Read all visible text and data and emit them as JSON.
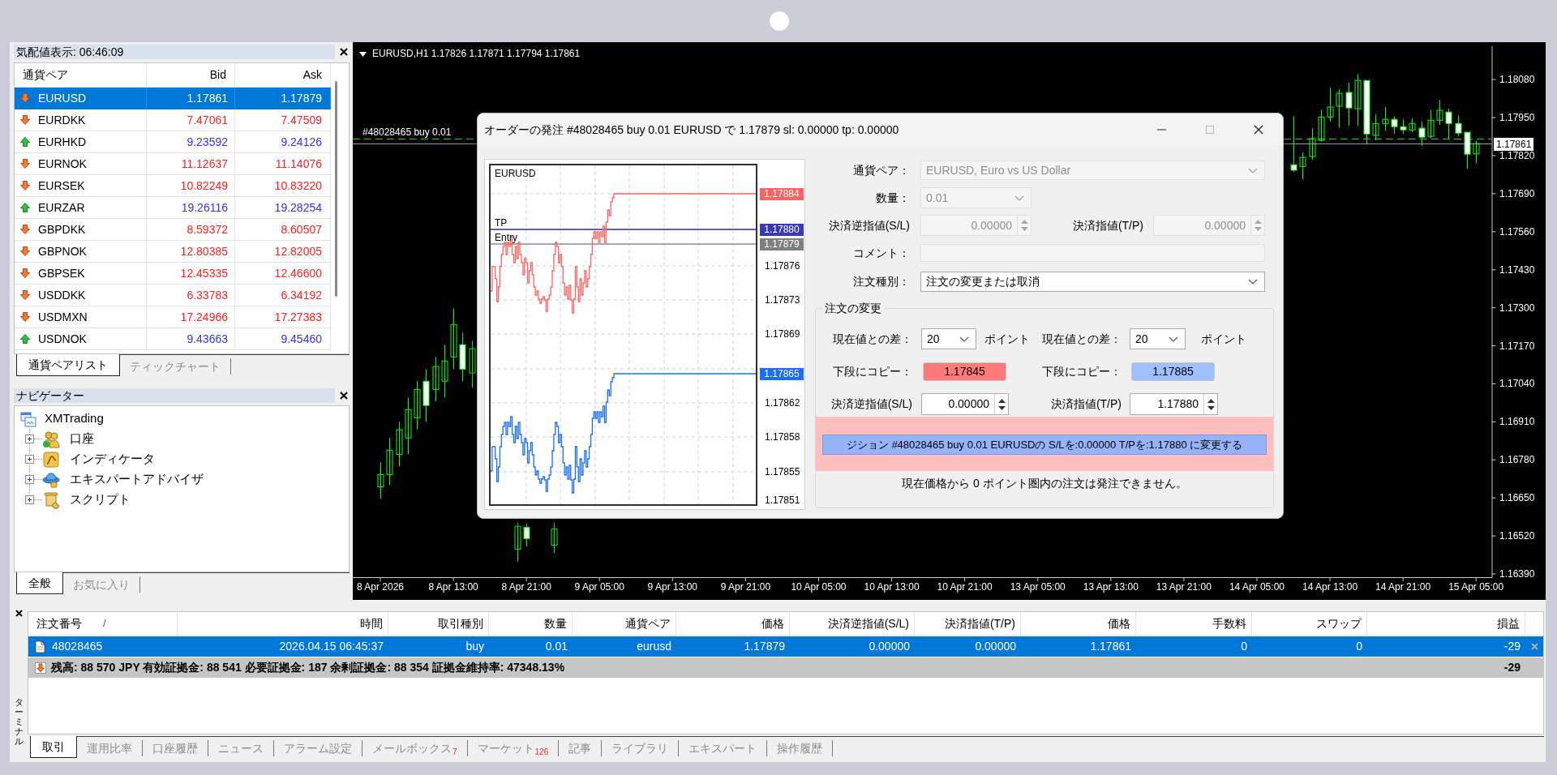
{
  "market_watch": {
    "title": "気配値表示: 06:46:09",
    "columns": [
      "通貨ペア",
      "Bid",
      "Ask"
    ],
    "rows": [
      {
        "symbol": "EURUSD",
        "bid": "1.17861",
        "ask": "1.17879",
        "rising": false,
        "selected": true
      },
      {
        "symbol": "EURDKK",
        "bid": "7.47061",
        "ask": "7.47509",
        "rising": false,
        "selected": false
      },
      {
        "symbol": "EURHKD",
        "bid": "9.23592",
        "ask": "9.24126",
        "rising": true,
        "selected": false
      },
      {
        "symbol": "EURNOK",
        "bid": "11.12637",
        "ask": "11.14076",
        "rising": false,
        "selected": false
      },
      {
        "symbol": "EURSEK",
        "bid": "10.82249",
        "ask": "10.83220",
        "rising": false,
        "selected": false
      },
      {
        "symbol": "EURZAR",
        "bid": "19.26116",
        "ask": "19.28254",
        "rising": true,
        "selected": false
      },
      {
        "symbol": "GBPDKK",
        "bid": "8.59372",
        "ask": "8.60507",
        "rising": false,
        "selected": false
      },
      {
        "symbol": "GBPNOK",
        "bid": "12.80385",
        "ask": "12.82005",
        "rising": false,
        "selected": false
      },
      {
        "symbol": "GBPSEK",
        "bid": "12.45335",
        "ask": "12.46600",
        "rising": false,
        "selected": false
      },
      {
        "symbol": "USDDKK",
        "bid": "6.33783",
        "ask": "6.34192",
        "rising": false,
        "selected": false
      },
      {
        "symbol": "USDMXN",
        "bid": "17.24966",
        "ask": "17.27383",
        "rising": false,
        "selected": false
      },
      {
        "symbol": "USDNOK",
        "bid": "9.43663",
        "ask": "9.45460",
        "rising": true,
        "selected": false
      }
    ],
    "tabs": [
      {
        "label": "通貨ペアリスト",
        "selected": true
      },
      {
        "label": "ティックチャート",
        "selected": false
      }
    ]
  },
  "navigator": {
    "title": "ナビゲーター",
    "tree": [
      {
        "label": "XMTrading",
        "kind": "broker",
        "children": [
          {
            "label": "口座",
            "kind": "accounts",
            "expanded": false
          },
          {
            "label": "インディケータ",
            "kind": "indicators",
            "expanded": false
          },
          {
            "label": "エキスパートアドバイザ",
            "kind": "experts",
            "expanded": false
          },
          {
            "label": "スクリプト",
            "kind": "scripts",
            "expanded": false
          }
        ]
      }
    ],
    "tabs": [
      {
        "label": "全般",
        "selected": true
      },
      {
        "label": "お気に入り",
        "selected": false
      }
    ]
  },
  "chart": {
    "title": "EURUSD,H1 1.17826 1.17871 1.17794 1.17861",
    "chart_data": {
      "type": "candlestick",
      "ylim": [
        1.16379,
        1.18194
      ],
      "categories": [
        "8 Apr 2026",
        null,
        null,
        null,
        null,
        null,
        null,
        null,
        "8 Apr 13:00",
        null,
        null,
        null,
        null,
        null,
        null,
        null,
        "8 Apr 21:00",
        null,
        null,
        null,
        null,
        null,
        null,
        null,
        "9 Apr 05:00",
        null,
        null,
        null,
        null,
        null,
        null,
        null,
        "9 Apr 13:00",
        null,
        null,
        null,
        null,
        null,
        null,
        null,
        "9 Apr 21:00",
        null,
        null,
        null,
        null,
        null,
        null,
        null,
        "10 Apr 05:00",
        null,
        null,
        null,
        null,
        null,
        null,
        null,
        "10 Apr 13:00",
        null,
        null,
        null,
        null,
        null,
        null,
        null,
        "10 Apr 21:00",
        null,
        null,
        null,
        null,
        null,
        null,
        null,
        "13 Apr 05:00",
        null,
        null,
        null,
        null,
        null,
        null,
        null,
        "13 Apr 13:00",
        null,
        null,
        null,
        null,
        null,
        null,
        null,
        "13 Apr 21:00",
        null,
        null,
        null,
        null,
        null,
        null,
        null,
        "14 Apr 05:00",
        null,
        null,
        null,
        null,
        null,
        null,
        null,
        "14 Apr 13:00",
        null,
        null,
        null,
        null,
        null,
        null,
        null,
        "14 Apr 21:00",
        null,
        null,
        null,
        null,
        null,
        null,
        null,
        "15 Apr 05:00"
      ],
      "ohlc": [
        [
          1.16688,
          1.16772,
          1.16647,
          1.1673
        ],
        [
          1.1673,
          1.16855,
          1.16694,
          1.16813
        ],
        [
          1.16799,
          1.1691,
          1.16758,
          1.16883
        ],
        [
          1.16855,
          1.16993,
          1.16799,
          1.16952
        ],
        [
          1.16924,
          1.17049,
          1.16883,
          1.17021
        ],
        [
          1.17049,
          1.1709,
          1.1691,
          1.16966
        ],
        [
          1.17021,
          1.17132,
          1.1698,
          1.17099
        ],
        [
          1.17049,
          1.17174,
          1.16993,
          1.17118
        ],
        [
          1.17132,
          1.17298,
          1.1709,
          1.17243
        ],
        [
          1.17174,
          1.17215,
          1.17049,
          1.1709
        ],
        [
          1.17077,
          1.17187,
          1.17027,
          1.1716
        ],
        null,
        null,
        null,
        null,
        [
          1.16475,
          1.16566,
          1.16433,
          1.16553
        ],
        [
          1.1655,
          1.16564,
          1.16483,
          1.16511
        ],
        null,
        null,
        [
          1.16489,
          1.16566,
          1.16461,
          1.16544
        ],
        null,
        null,
        null,
        null,
        null,
        null,
        null,
        null,
        null,
        null,
        null,
        null,
        null,
        null,
        null,
        null,
        null,
        null,
        null,
        null,
        null,
        null,
        null,
        null,
        null,
        null,
        null,
        null,
        null,
        null,
        null,
        null,
        null,
        null,
        null,
        null,
        null,
        null,
        null,
        null,
        null,
        null,
        null,
        null,
        null,
        null,
        null,
        null,
        null,
        null,
        null,
        null,
        null,
        null,
        null,
        null,
        null,
        null,
        null,
        null,
        null,
        null,
        null,
        null,
        null,
        null,
        null,
        null,
        null,
        null,
        null,
        null,
        null,
        null,
        null,
        null,
        null,
        null,
        null,
        null,
        [
          1.17789,
          1.17955,
          1.17764,
          1.1777
        ],
        [
          1.17783,
          1.17831,
          1.17739,
          1.17814
        ],
        [
          1.17817,
          1.17914,
          1.17806,
          1.17878
        ],
        [
          1.17872,
          1.17977,
          1.17869,
          1.17952
        ],
        [
          1.17952,
          1.18052,
          1.17936,
          1.17986
        ],
        [
          1.17989,
          1.18047,
          1.17916,
          1.18033
        ],
        [
          1.18036,
          1.18069,
          1.17922,
          1.17983
        ],
        [
          1.1798,
          1.18099,
          1.17922,
          1.18077
        ],
        [
          1.18077,
          1.18077,
          1.17861,
          1.17894
        ],
        [
          1.17889,
          1.17961,
          1.17872,
          1.1793
        ],
        [
          1.1793,
          1.17986,
          1.17905,
          1.17944
        ],
        [
          1.17944,
          1.17955,
          1.17894,
          1.17919
        ],
        [
          1.17919,
          1.17944,
          1.17894,
          1.17908
        ],
        [
          1.17908,
          1.17947,
          1.179,
          1.1793
        ],
        [
          1.17914,
          1.17936,
          1.17853,
          1.17883
        ],
        [
          1.17886,
          1.17977,
          1.1788,
          1.17941
        ],
        [
          1.17941,
          1.18011,
          1.17925,
          1.17975
        ],
        [
          1.17969,
          1.1798,
          1.17878,
          1.1793
        ],
        [
          1.1793,
          1.17958,
          1.17886,
          1.17897
        ],
        [
          1.179,
          1.179,
          1.17775,
          1.17825
        ],
        [
          1.17826,
          1.17871,
          1.17794,
          1.17861
        ]
      ],
      "yticks": [
        {
          "value": 1.1808,
          "label": "1.18080"
        },
        {
          "value": 1.1795,
          "label": "1.17950"
        },
        {
          "value": 1.1782,
          "label": "1.17820"
        },
        {
          "value": 1.1769,
          "label": "1.17690"
        },
        {
          "value": 1.1756,
          "label": "1.17560"
        },
        {
          "value": 1.1743,
          "label": "1.17430"
        },
        {
          "value": 1.173,
          "label": "1.17300"
        },
        {
          "value": 1.1717,
          "label": "1.17170"
        },
        {
          "value": 1.1704,
          "label": "1.17040"
        },
        {
          "value": 1.1691,
          "label": "1.16910"
        },
        {
          "value": 1.1678,
          "label": "1.16780"
        },
        {
          "value": 1.1665,
          "label": "1.16650"
        },
        {
          "value": 1.1652,
          "label": "1.16520"
        },
        {
          "value": 1.1639,
          "label": "1.16390"
        }
      ],
      "ref_lines": [
        {
          "axis": "y",
          "value": 1.17879,
          "label": "#48028465 buy 0.01",
          "color": "#1fd01f"
        },
        {
          "axis": "y",
          "value": 1.17861,
          "label": "1.17861",
          "color": "#8fa0b0"
        }
      ]
    }
  },
  "order_dialog": {
    "title": "オーダーの発注 #48028465 buy 0.01 EURUSD で 1.17879 sl: 0.00000 tp: 0.00000",
    "tick_chart": {
      "symbol": "EURUSD",
      "tp_label": "TP",
      "entry_label": "Entry",
      "price_axis": [
        "1.17876",
        "1.17873",
        "1.17869",
        "1.17862",
        "1.17858",
        "1.17855",
        "1.17851"
      ],
      "price_tags": [
        {
          "text": "1.17884",
          "color": "#ff6262"
        },
        {
          "text": "1.17880",
          "color": "#3a3ab4"
        },
        {
          "text": "1.17879",
          "color": "#7f7f7f"
        },
        {
          "text": "1.17865",
          "color": "#1a6dff"
        }
      ]
    },
    "symbol": {
      "label": "通貨ペア：",
      "value": "EURUSD, Euro vs US Dollar",
      "disabled": true
    },
    "volume": {
      "label": "数量：",
      "value": "0.01",
      "disabled": true
    },
    "stop_loss": {
      "label": "決済逆指値(S/L)",
      "value": "0.00000",
      "disabled": true
    },
    "take_profit": {
      "label": "決済指値(T/P)",
      "value": "0.00000",
      "disabled": true
    },
    "comment": {
      "label": "コメント：",
      "disabled": true
    },
    "order_type": {
      "label": "注文種別：",
      "value": "注文の変更または取消",
      "disabled": false
    },
    "modify": {
      "title": "注文の変更",
      "sides": [
        {
          "distance_label": "現在値との差：",
          "distance": "20",
          "unit": "ポイント",
          "copy_label": "下段にコピー：",
          "copy_value": "1.17845",
          "color": "#ff7b7b",
          "price_label": "決済逆指値(S/L)",
          "price": "0.00000"
        },
        {
          "distance_label": "現在値との差：",
          "distance": "20",
          "unit": "ポイント",
          "copy_label": "下段にコピー：",
          "copy_value": "1.17885",
          "color": "#9fbfff",
          "price_label": "決済指値(T/P)",
          "price": "1.17880"
        }
      ],
      "modify_button": "ジション #48028465 buy 0.01 EURUSDの S/Lを:0.00000 T/Pを:1.17880 に変更する",
      "note": "現在価格から 0 ポイント圏内の注文は発注できません。"
    }
  },
  "terminal": {
    "label": "ターミナル",
    "columns": [
      "注文番号",
      "時間",
      "取引種別",
      "数量",
      "通貨ペア",
      "価格",
      "決済逆指値(S/L)",
      "決済指値(T/P)",
      "価格",
      "手数料",
      "スワップ",
      "損益"
    ],
    "sort_mark": "/",
    "orders": [
      {
        "cells": [
          "48028465",
          "2026.04.15 06:45:37",
          "buy",
          "0.01",
          "eurusd",
          "1.17879",
          "0.00000",
          "0.00000",
          "1.17861",
          "0",
          "0",
          "-29"
        ],
        "selected": true
      }
    ],
    "summary": {
      "text": "残高: 88 570 JPY 有効証拠金: 88 541 必要証拠金: 187 余剰証拠金: 88 354 証拠金維持率: 47348.13%",
      "profit": "-29"
    },
    "tabs": [
      {
        "label": "取引",
        "selected": true
      },
      {
        "label": "運用比率",
        "selected": false
      },
      {
        "label": "口座履歴",
        "selected": false
      },
      {
        "label": "ニュース",
        "selected": false
      },
      {
        "label": "アラーム設定",
        "selected": false
      },
      {
        "label": "メールボックス",
        "count": "7",
        "selected": false
      },
      {
        "label": "マーケット",
        "count": "126",
        "selected": false
      },
      {
        "label": "記事",
        "selected": false
      },
      {
        "label": "ライブラリ",
        "selected": false
      },
      {
        "label": "エキスパート",
        "selected": false
      },
      {
        "label": "操作履歴",
        "selected": false
      }
    ]
  }
}
